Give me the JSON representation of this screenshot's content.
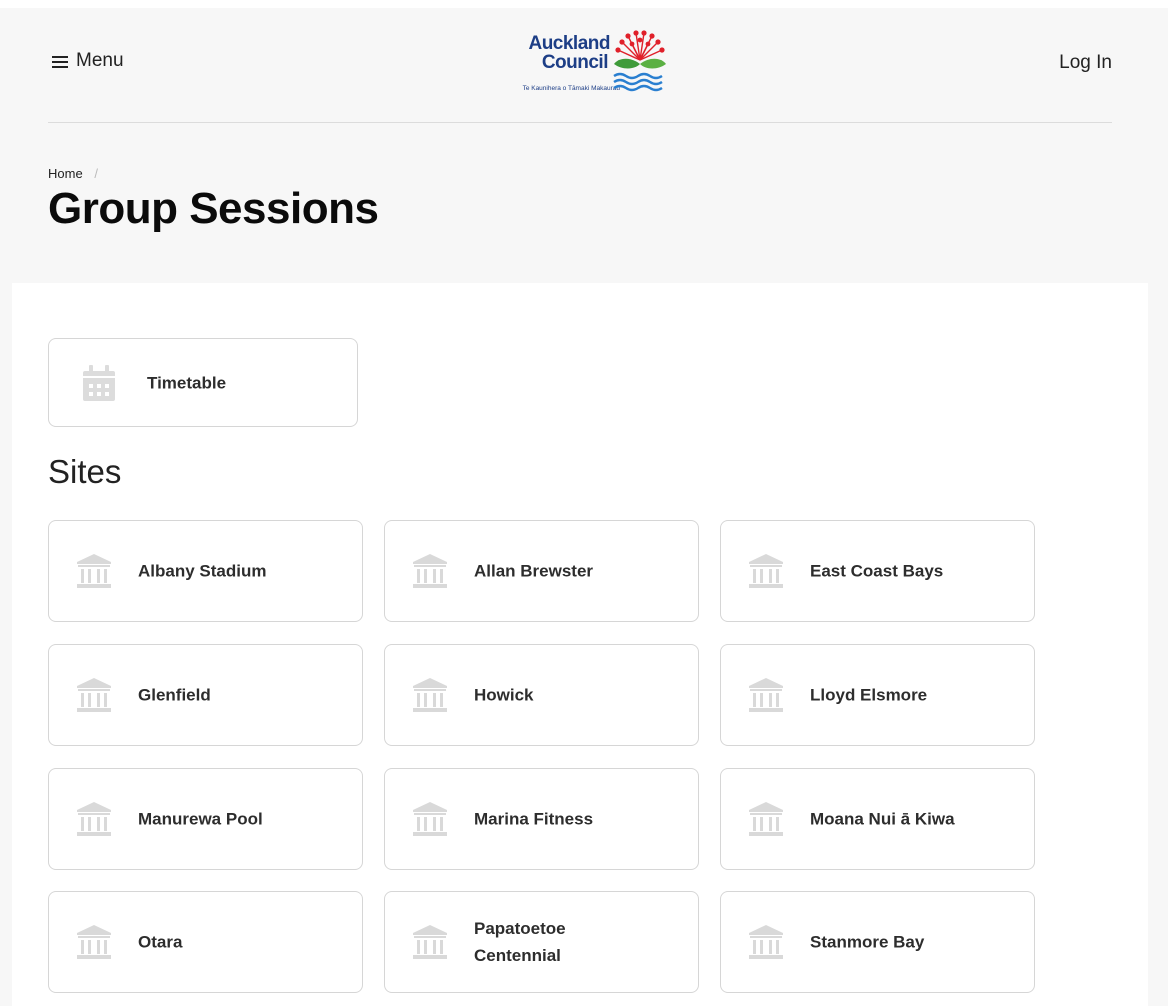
{
  "header": {
    "menu_label": "Menu",
    "login_label": "Log In",
    "logo": {
      "line1": "Auckland",
      "line2": "Council",
      "tagline": "Te Kaunihera o Tāmaki Makaurau"
    }
  },
  "breadcrumb": {
    "home": "Home",
    "separator": "/"
  },
  "page": {
    "title": "Group Sessions"
  },
  "timetable": {
    "label": "Timetable",
    "icon": "calendar-icon"
  },
  "sites": {
    "heading": "Sites",
    "icon": "building-icon",
    "items": [
      {
        "label": "Albany Stadium"
      },
      {
        "label": "Allan Brewster"
      },
      {
        "label": "East Coast Bays"
      },
      {
        "label": "Glenfield"
      },
      {
        "label": "Howick"
      },
      {
        "label": "Lloyd Elsmore"
      },
      {
        "label": "Manurewa Pool"
      },
      {
        "label": "Marina Fitness"
      },
      {
        "label": "Moana Nui ā Kiwa"
      },
      {
        "label": "Otara"
      },
      {
        "label": "Papatoetoe Centennial"
      },
      {
        "label": "Stanmore Bay"
      }
    ]
  },
  "colors": {
    "logo_blue": "#1d3e86",
    "logo_red": "#e0202a",
    "logo_green": "#3f9b3a",
    "page_bg": "#f7f7f7",
    "icon_gray": "#d9d9d9"
  }
}
